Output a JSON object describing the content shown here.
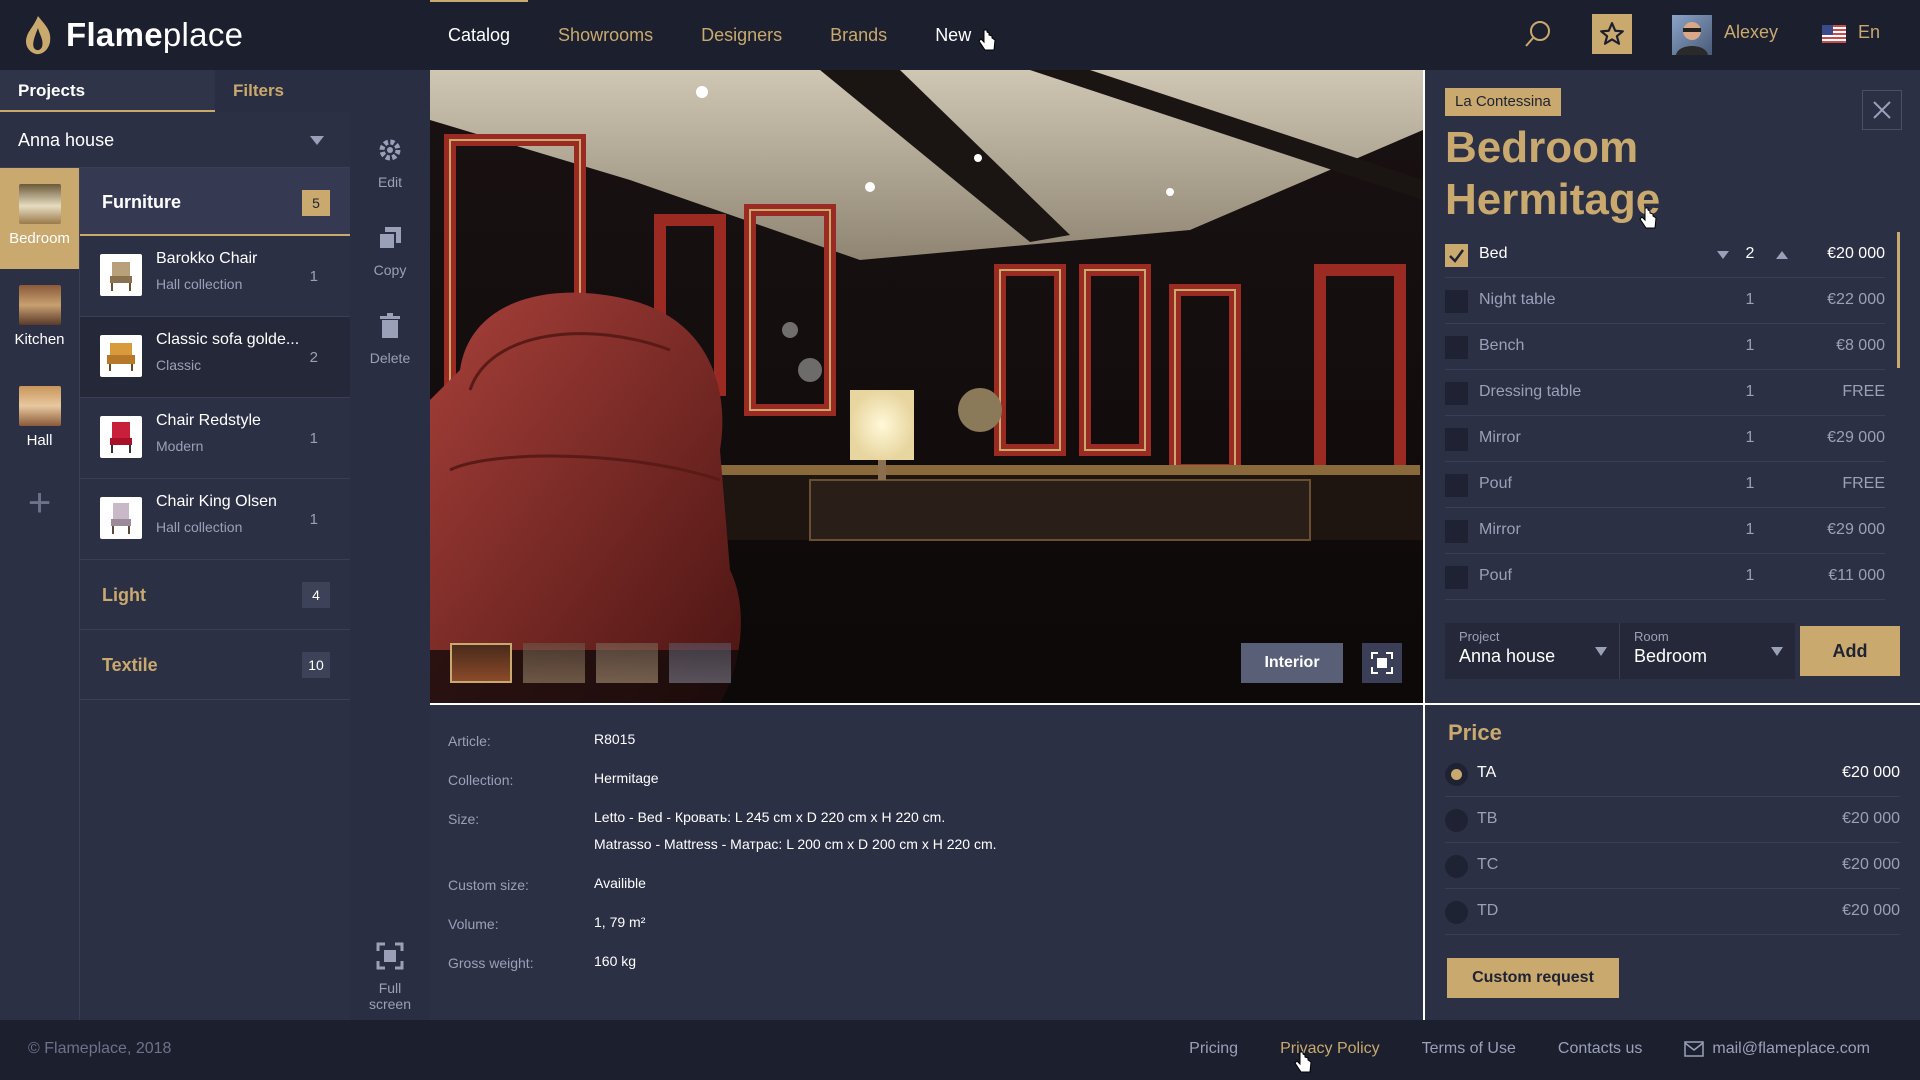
{
  "app": {
    "logo_bold": "Flame",
    "logo_light": "place"
  },
  "nav": {
    "items": [
      "Catalog",
      "Showrooms",
      "Designers",
      "Brands",
      "New"
    ],
    "active": "Catalog"
  },
  "user": {
    "name": "Alexey",
    "lang": "En"
  },
  "left_tabs": {
    "projects": "Projects",
    "filters": "Filters"
  },
  "project_select": {
    "value": "Anna house"
  },
  "rooms": [
    {
      "label": "Bedroom",
      "active": true
    },
    {
      "label": "Kitchen",
      "active": false
    },
    {
      "label": "Hall",
      "active": false
    }
  ],
  "categories": {
    "furniture": {
      "label": "Furniture",
      "count": "5"
    },
    "light": {
      "label": "Light",
      "count": "4"
    },
    "textile": {
      "label": "Textile",
      "count": "10"
    }
  },
  "items": [
    {
      "name": "Barokko Chair",
      "collection": "Hall collection",
      "qty": "1"
    },
    {
      "name": "Classic sofa golde...",
      "collection": "Classic",
      "qty": "2"
    },
    {
      "name": "Chair Redstyle",
      "collection": "Modern",
      "qty": "1"
    },
    {
      "name": "Chair King Olsen",
      "collection": "Hall collection",
      "qty": "1"
    }
  ],
  "tools": {
    "edit": "Edit",
    "copy": "Copy",
    "delete": "Delete",
    "fullscreen_1": "Full",
    "fullscreen_2": "screen"
  },
  "viewer": {
    "interior_label": "Interior"
  },
  "details": {
    "article_k": "Article:",
    "article_v": "R8015",
    "collection_k": "Collection:",
    "collection_v": "Hermitage",
    "size_k": "Size:",
    "size_v1": "Letto - Bed - Кровать: L 245 cm x D 220 cm x H 220 cm.",
    "size_v2": "Matrasso - Mattress - Матрас: L 200 cm x D 200 cm x H 220 cm.",
    "custom_k": "Custom size:",
    "custom_v": "Availible",
    "volume_k": "Volume:",
    "volume_v": "1, 79 m²",
    "weight_k": "Gross weight:",
    "weight_v": "160 kg"
  },
  "panel": {
    "brand": "La Contessina",
    "title_1": "Bedroom",
    "title_2": "Hermitage",
    "rows": [
      {
        "name": "Bed",
        "qty": "2",
        "price": "€20 000",
        "checked": true
      },
      {
        "name": "Night table",
        "qty": "1",
        "price": "€22 000",
        "checked": false
      },
      {
        "name": "Bench",
        "qty": "1",
        "price": "€8 000",
        "checked": false
      },
      {
        "name": "Dressing table",
        "qty": "1",
        "price": "FREE",
        "checked": false
      },
      {
        "name": "Mirror",
        "qty": "1",
        "price": "€29 000",
        "checked": false
      },
      {
        "name": "Pouf",
        "qty": "1",
        "price": "FREE",
        "checked": false
      },
      {
        "name": "Mirror",
        "qty": "1",
        "price": "€29 000",
        "checked": false
      },
      {
        "name": "Pouf",
        "qty": "1",
        "price": "€11 000",
        "checked": false
      }
    ],
    "project_label": "Project",
    "project_value": "Anna house",
    "room_label": "Room",
    "room_value": "Bedroom",
    "add_label": "Add"
  },
  "price": {
    "title": "Price",
    "options": [
      {
        "name": "TA",
        "value": "€20 000",
        "selected": true
      },
      {
        "name": "TB",
        "value": "€20 000",
        "selected": false
      },
      {
        "name": "TC",
        "value": "€20 000",
        "selected": false
      },
      {
        "name": "TD",
        "value": "€20 000",
        "selected": false
      }
    ],
    "custom_request": "Custom request"
  },
  "footer": {
    "copyright": "© Flameplace, 2018",
    "pricing": "Pricing",
    "privacy": "Privacy Policy",
    "terms": "Terms of Use",
    "contacts": "Contacts us",
    "email": "mail@flameplace.com"
  },
  "colors": {
    "accent": "#c9a96e",
    "bg": "#1f2233",
    "panel": "#2c3045"
  }
}
